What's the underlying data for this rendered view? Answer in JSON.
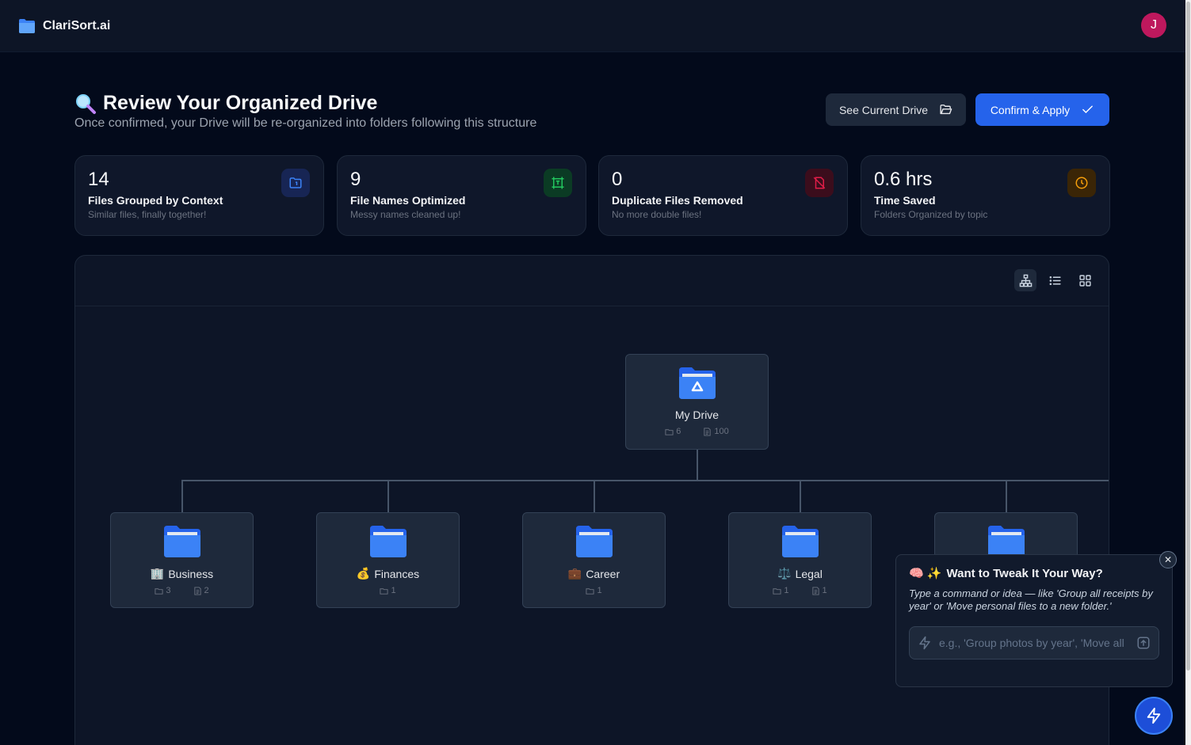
{
  "app": {
    "name": "ClariSort.ai",
    "avatar_initial": "J"
  },
  "header": {
    "title": "Review Your Organized Drive",
    "subtitle": "Once confirmed, your Drive will be re-organized into folders following this structure",
    "see_current_label": "See Current Drive",
    "confirm_label": "Confirm & Apply"
  },
  "stats": [
    {
      "value": "14",
      "label": "Files Grouped by Context",
      "desc": "Similar files, finally together!",
      "icon": "file-group-icon",
      "color": "#3b82f6"
    },
    {
      "value": "9",
      "label": "File Names Optimized",
      "desc": "Messy names cleaned up!",
      "icon": "rename-icon",
      "color": "#22c55e"
    },
    {
      "value": "0",
      "label": "Duplicate Files Removed",
      "desc": "No more double files!",
      "icon": "no-duplicate-icon",
      "color": "#e11d48"
    },
    {
      "value": "0.6 hrs",
      "label": "Time Saved",
      "desc": "Folders Organized by topic",
      "icon": "clock-icon",
      "color": "#f59e0b"
    }
  ],
  "tree": {
    "root": {
      "label": "My Drive",
      "folders": "6",
      "files": "100"
    },
    "children": [
      {
        "emoji": "🏢",
        "label": "Business",
        "folders": "3",
        "files": "2"
      },
      {
        "emoji": "💰",
        "label": "Finances",
        "folders": "1"
      },
      {
        "emoji": "💼",
        "label": "Career",
        "folders": "1"
      },
      {
        "emoji": "⚖️",
        "label": "Legal",
        "folders": "1",
        "files": "1"
      }
    ]
  },
  "tweak": {
    "emoji": "🧠 ✨",
    "title": "Want to Tweak It Your Way?",
    "desc": "Type a command or idea — like 'Group all receipts by year' or 'Move personal files to a new folder.'",
    "placeholder": "e.g., 'Group photos by year', 'Move all"
  },
  "colors": {
    "accent": "#2563eb",
    "folder": "#3b82f6"
  }
}
